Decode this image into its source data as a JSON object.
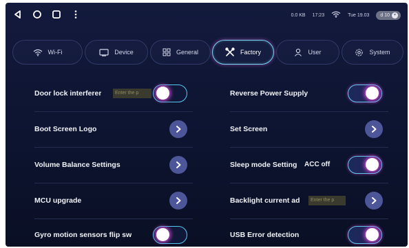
{
  "statusbar": {
    "speed": "0.0 KB",
    "time": "17:23",
    "date": "Tue 19.03",
    "volume": "d 10"
  },
  "tabs": [
    {
      "label": "Wi-Fi",
      "icon": "wifi-icon",
      "active": false
    },
    {
      "label": "Device",
      "icon": "monitor-icon",
      "active": false
    },
    {
      "label": "General",
      "icon": "grid-icon",
      "active": false
    },
    {
      "label": "Factory",
      "icon": "tools-icon",
      "active": true
    },
    {
      "label": "User",
      "icon": "user-icon",
      "active": false
    },
    {
      "label": "System",
      "icon": "gear-icon",
      "active": false
    }
  ],
  "left_settings": [
    {
      "label": "Door lock interferer",
      "control": "toggle",
      "on": false,
      "input_placeholder": "Enter the p"
    },
    {
      "label": "Boot Screen Logo",
      "control": "chevron"
    },
    {
      "label": "Volume Balance Settings",
      "control": "chevron"
    },
    {
      "label": "MCU upgrade",
      "control": "chevron"
    },
    {
      "label": "Gyro motion sensors flip sw",
      "control": "toggle",
      "on": false
    }
  ],
  "right_settings": [
    {
      "label": "Reverse Power Supply",
      "control": "toggle",
      "on": true
    },
    {
      "label": "Set Screen",
      "control": "chevron"
    },
    {
      "label": "Sleep mode Setting",
      "control": "toggle",
      "on": true,
      "value": "ACC off"
    },
    {
      "label": "Backlight current ad",
      "control": "chevron",
      "input_placeholder": "Enter the p"
    },
    {
      "label": "USB Error detection",
      "control": "toggle",
      "on": true
    }
  ],
  "colors": {
    "background": "#0d1430",
    "accent_glow": "#e050e0",
    "accent_border": "#63c9f1",
    "chevron_bg": "#4c5699"
  }
}
